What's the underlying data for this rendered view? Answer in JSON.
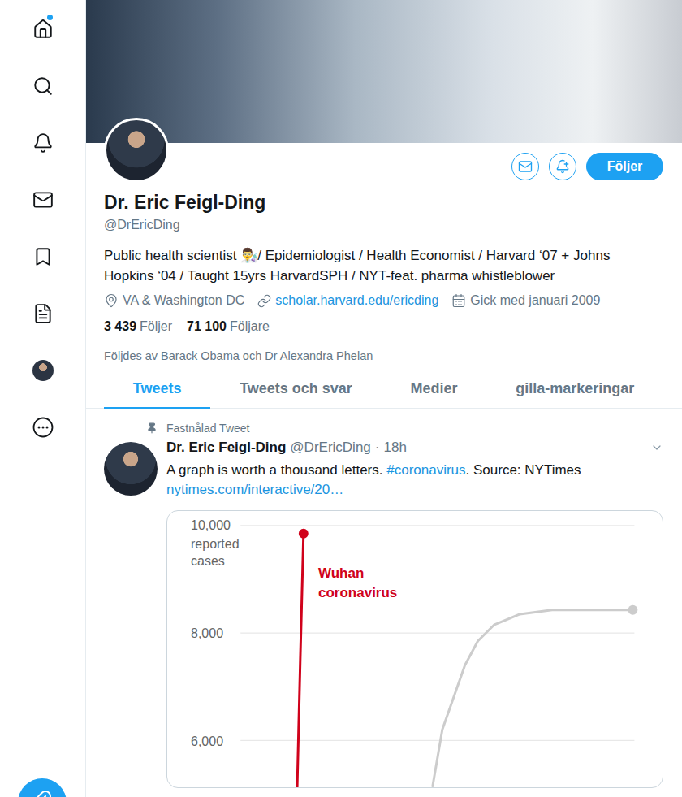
{
  "sidebar": {
    "items": [
      {
        "kind": "icon",
        "unread": true
      },
      {
        "kind": "icon",
        "unread": false
      },
      {
        "kind": "icon",
        "unread": false
      },
      {
        "kind": "icon",
        "unread": false
      },
      {
        "kind": "icon",
        "unread": false
      },
      {
        "kind": "icon",
        "unread": false
      },
      {
        "kind": "avatar",
        "unread": false
      },
      {
        "kind": "icon",
        "unread": false
      }
    ]
  },
  "profile": {
    "name": "Dr. Eric Feigl-Ding",
    "handle": "@DrEricDing",
    "bio": "Public health scientist 👨‍🔬/ Epidemiologist / Health Economist / Harvard ‘07 + Johns Hopkins ‘04 / Taught 15yrs HarvardSPH / NYT-feat. pharma whistleblower",
    "location": "VA & Washington DC",
    "website": "scholar.harvard.edu/ericding",
    "joined": "Gick med januari 2009",
    "stats": [
      {
        "count": "3 439",
        "label": "Följer"
      },
      {
        "count": "71 100",
        "label": "Följare"
      }
    ],
    "followed_by": "Följdes av Barack Obama och Dr Alexandra Phelan",
    "follow_button": {
      "label": "Följer",
      "following": true
    }
  },
  "tabs": [
    {
      "label": "Tweets",
      "selected": true
    },
    {
      "label": "Tweets och svar",
      "selected": false
    },
    {
      "label": "Medier",
      "selected": false
    },
    {
      "label": "gilla-markeringar",
      "selected": false
    }
  ],
  "pinned_tweet": {
    "pinned_label": "Fastnålad Tweet",
    "author": "Dr. Eric Feigl-Ding",
    "handle": "@DrEricDing",
    "separator": "·",
    "time": "18h",
    "text": [
      {
        "kind": "plain",
        "text": "A graph is worth a thousand letters. "
      },
      {
        "kind": "hashtag",
        "text": "#coronavirus"
      },
      {
        "kind": "plain",
        "text": ". Source: NYTimes"
      }
    ],
    "link": "nytimes.com/interactive/20…",
    "chart": {
      "y_title": "reported cases",
      "y_ticks": [
        {
          "label": "10,000",
          "value": 10000
        },
        {
          "label": "8,000",
          "value": 8000
        },
        {
          "label": "6,000",
          "value": 6000
        }
      ],
      "series": [
        {
          "label": "Wuhan coronavirus",
          "color": "#d0021b",
          "days": [
            0,
            1,
            2
          ],
          "values": [
            5000,
            7500,
            9850
          ]
        },
        {
          "label": "",
          "color": "#cccccc",
          "days": [
            42,
            45,
            52,
            56,
            61,
            69,
            79,
            104
          ],
          "values": [
            5150,
            6200,
            7400,
            7850,
            8150,
            8350,
            8430,
            8430
          ]
        }
      ]
    }
  }
}
